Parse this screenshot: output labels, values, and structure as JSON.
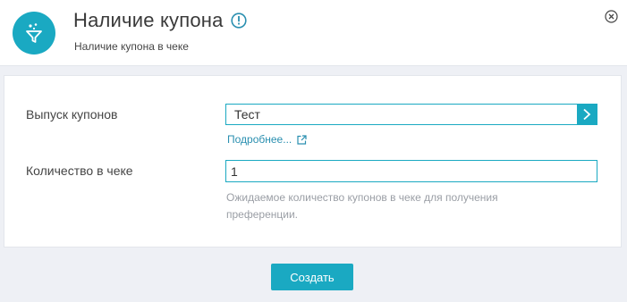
{
  "header": {
    "title": "Наличие купона",
    "subtitle": "Наличие купона в чеке",
    "logo_icon": "funnel-sparkle-icon",
    "info_icon": "info-circle-icon",
    "close_icon": "close-circle-icon"
  },
  "form": {
    "coupon_issue": {
      "label": "Выпуск купонов",
      "value": "Тест",
      "more_link": "Подробнее..."
    },
    "quantity": {
      "label": "Количество в чеке",
      "value": "1",
      "hint": "Ожидаемое количество купонов в чеке для получения преференции."
    }
  },
  "actions": {
    "create_label": "Создать"
  },
  "colors": {
    "accent": "#1aa9c2",
    "link": "#2a8fb0",
    "background": "#eef0f5"
  }
}
